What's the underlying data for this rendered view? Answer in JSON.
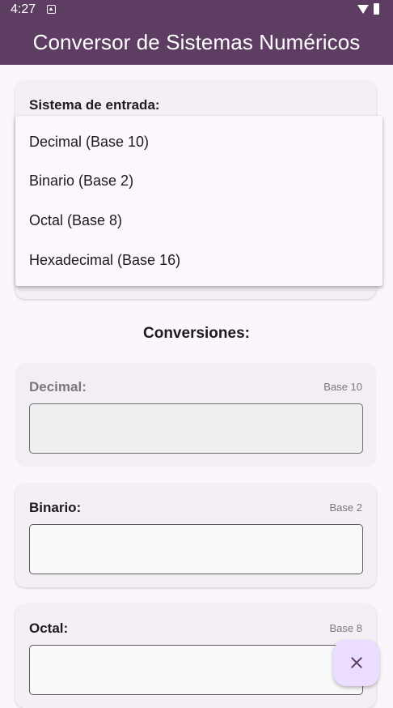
{
  "status_bar": {
    "time": "4:27",
    "icons": [
      "notification-icon",
      "wifi-icon",
      "battery-icon"
    ]
  },
  "app_bar": {
    "title": "Conversor de Sistemas Numéricos",
    "color": "#5E3D63"
  },
  "input_card": {
    "label": "Sistema de entrada:"
  },
  "dropdown": {
    "items": [
      "Decimal (Base 10)",
      "Binario (Base 2)",
      "Octal (Base 8)",
      "Hexadecimal (Base 16)"
    ]
  },
  "conversions": {
    "title": "Conversiones:",
    "cards": [
      {
        "label": "Decimal:",
        "base": "Base 10",
        "value": "",
        "disabled": true
      },
      {
        "label": "Binario:",
        "base": "Base 2",
        "value": ""
      },
      {
        "label": "Octal:",
        "base": "Base 8",
        "value": ""
      }
    ]
  },
  "fab": {
    "icon": "close-icon"
  }
}
